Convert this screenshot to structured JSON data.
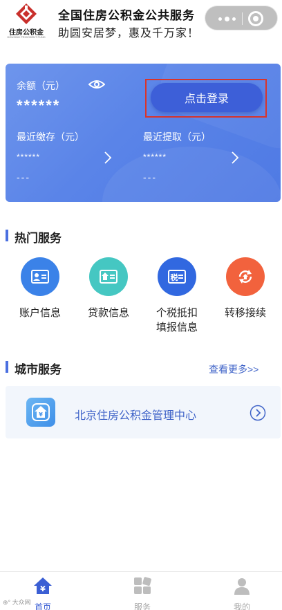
{
  "header": {
    "logo_text": "住房公积金",
    "logo_subtext": "HOUSING PROVIDENT FUND",
    "title": "全国住房公积金公共服务",
    "slogan": "助圆安居梦，惠及千万家！"
  },
  "balance_card": {
    "balance_label": "余额（元）",
    "balance_value": "******",
    "login_button": "点击登录",
    "recent_deposit_label": "最近缴存（元）",
    "recent_deposit_value": "******",
    "recent_deposit_date": "---",
    "recent_withdraw_label": "最近提取（元）",
    "recent_withdraw_value": "******",
    "recent_withdraw_date": "---",
    "gradient_start": "#6e95ec",
    "gradient_end": "#4f7ae4",
    "highlight_color": "#d9342b"
  },
  "hot_services": {
    "title": "热门服务",
    "items": [
      {
        "label": "账户信息",
        "icon": "account-card-icon",
        "color": "#3b82e8"
      },
      {
        "label": "贷款信息",
        "icon": "loan-house-icon",
        "color": "#45c7c2"
      },
      {
        "label_line1": "个税抵扣",
        "label_line2": "填报信息",
        "icon": "tax-icon",
        "icon_text": "税",
        "color": "#3168e0"
      },
      {
        "label": "转移接续",
        "icon": "transfer-refresh-icon",
        "color": "#f2623d"
      }
    ]
  },
  "city_services": {
    "title": "城市服务",
    "more_link": "查看更多>>",
    "items": [
      {
        "name": "北京住房公积金管理中心",
        "icon": "house-yuan-icon"
      }
    ]
  },
  "tabbar": {
    "items": [
      {
        "label": "首页",
        "icon": "home-yuan-icon",
        "active": true
      },
      {
        "label": "服务",
        "icon": "grid-service-icon",
        "active": false
      },
      {
        "label": "我的",
        "icon": "person-icon",
        "active": false
      }
    ],
    "active_color": "#3b5fd4",
    "inactive_color": "#aaaaaa"
  },
  "watermark": "⊕° 大众网"
}
